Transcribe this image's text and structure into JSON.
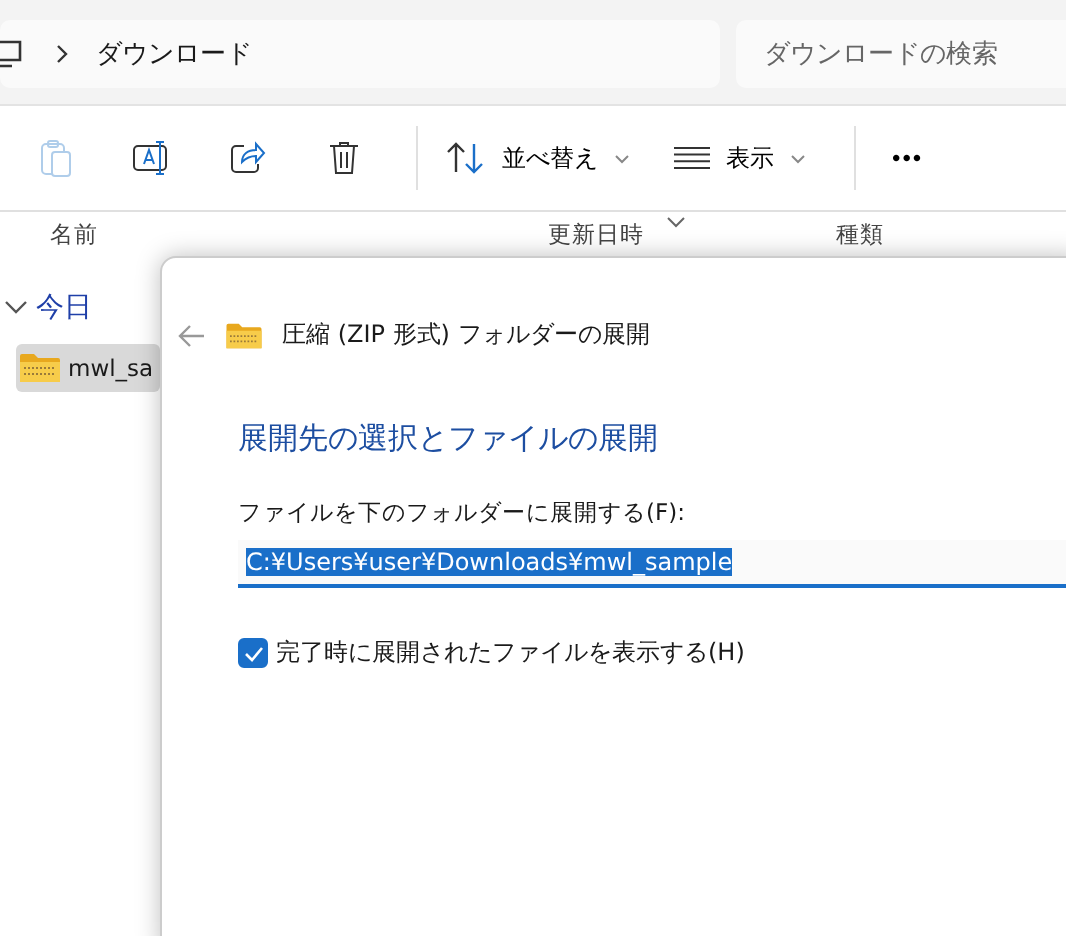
{
  "address_bar": {
    "path": [
      "ダウンロード"
    ]
  },
  "search": {
    "placeholder": "ダウンロードの検索"
  },
  "toolbar": {
    "items": [
      {
        "kind": "paste",
        "disabled": true
      },
      {
        "kind": "rename",
        "disabled": false
      },
      {
        "kind": "share",
        "disabled": false
      },
      {
        "kind": "delete",
        "disabled": false
      },
      {
        "kind": "separator"
      },
      {
        "kind": "sort",
        "label": "並べ替え"
      },
      {
        "kind": "view",
        "label": "表示"
      },
      {
        "kind": "separator"
      },
      {
        "kind": "more",
        "label": "•••"
      }
    ]
  },
  "file_list": {
    "columns": [
      "名前",
      "更新日時",
      "種類"
    ],
    "groups": [
      {
        "label": "今日",
        "expanded": true,
        "files": [
          {
            "name": "mwl_sa",
            "selected": true
          }
        ]
      }
    ]
  },
  "dialog": {
    "title": "圧縮 (ZIP 形式) フォルダーの展開",
    "heading": "展開先の選択とファイルの展開",
    "field_label": "ファイルを下のフォルダーに展開する(F):",
    "path": "C:¥Users¥user¥Downloads¥mwl_sample",
    "path_selected": true,
    "show_files": {
      "label": "完了時に展開されたファイルを表示する(H)",
      "checked": true
    }
  }
}
